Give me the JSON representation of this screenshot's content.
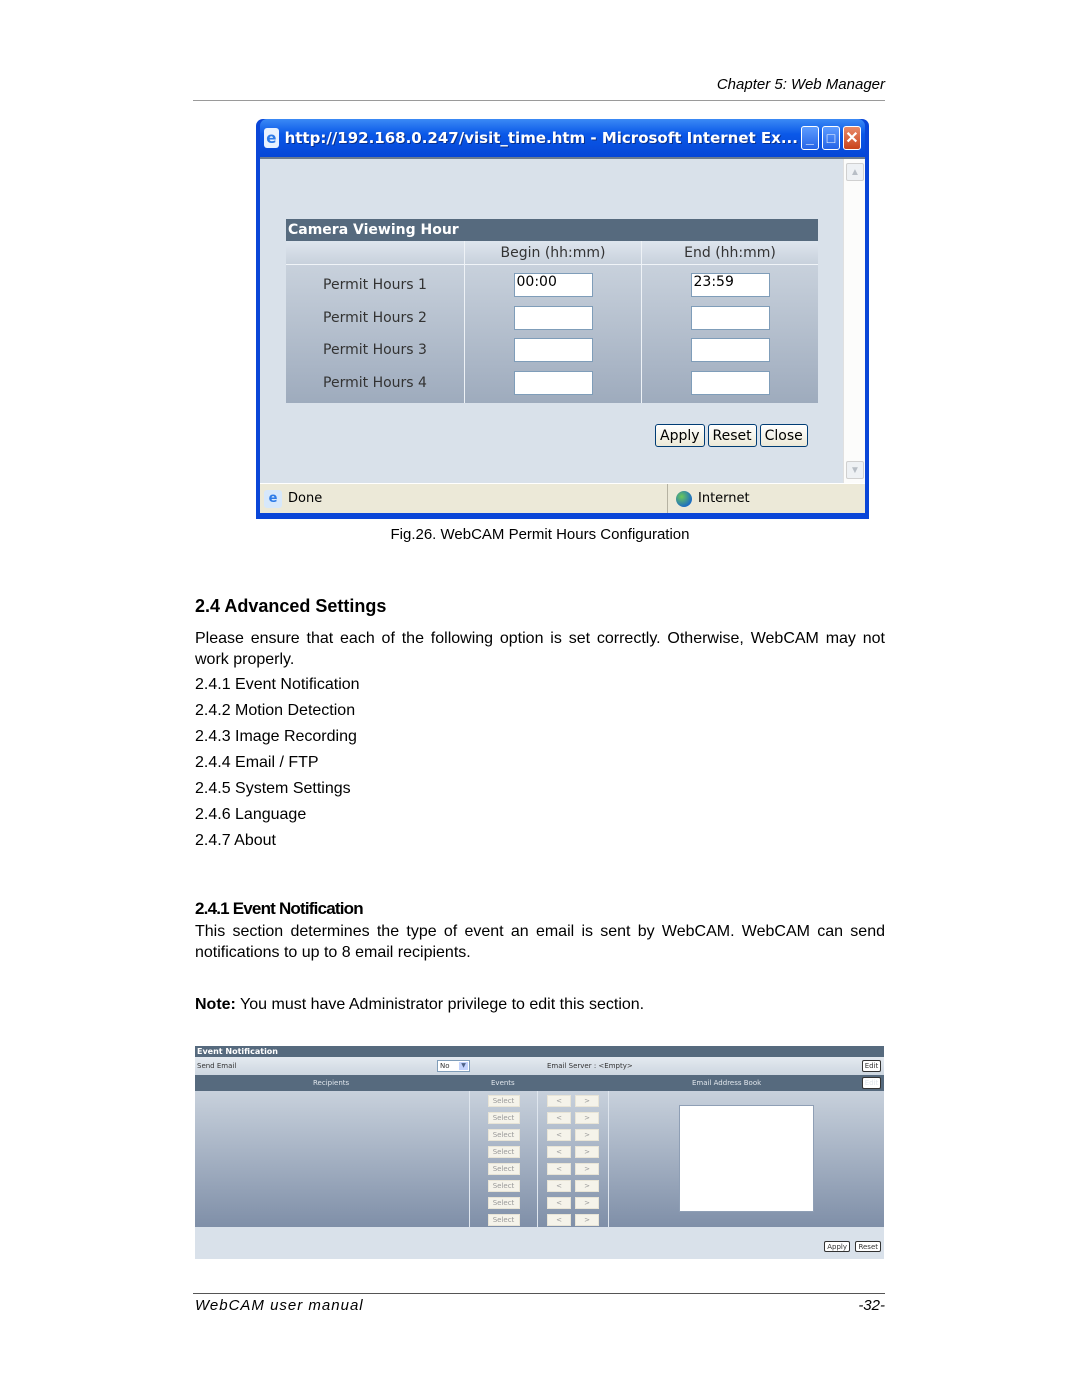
{
  "page_header": {
    "chapter": "Chapter 5: Web Manager"
  },
  "figure26": {
    "window": {
      "title": "http://192.168.0.247/visit_time.htm - Microsoft Internet Ex...",
      "minimize_glyph": "_",
      "maximize_glyph": "□",
      "close_glyph": "✕",
      "status_left": "Done",
      "status_zone": "Internet",
      "ie_glyph": "e"
    },
    "table": {
      "title": "Camera Viewing Hour",
      "col_begin": "Begin (hh:mm)",
      "col_end": "End (hh:mm)",
      "rows": [
        {
          "label": "Permit Hours 1",
          "begin": "00:00",
          "end": "23:59"
        },
        {
          "label": "Permit Hours 2",
          "begin": "",
          "end": ""
        },
        {
          "label": "Permit Hours 3",
          "begin": "",
          "end": ""
        },
        {
          "label": "Permit Hours 4",
          "begin": "",
          "end": ""
        }
      ]
    },
    "buttons": {
      "apply": "Apply",
      "reset": "Reset",
      "close": "Close"
    },
    "caption": "Fig.26.  WebCAM Permit Hours Configuration"
  },
  "section_24": {
    "heading": "2.4 Advanced Settings",
    "intro": "Please ensure that each of the following option is set correctly. Otherwise, WebCAM may not work properly.",
    "items": [
      "2.4.1 Event Notification",
      "2.4.2 Motion Detection",
      "2.4.3 Image Recording",
      "2.4.4 Email / FTP",
      "2.4.5 System Settings",
      "2.4.6 Language",
      "2.4.7 About"
    ]
  },
  "section_241": {
    "heading": "2.4.1 Event Notification",
    "body": "This section determines the type of event an email is sent by WebCAM.  WebCAM can send notifications to up to 8 email recipients.",
    "note_label": "Note:",
    "note_text": " You must have Administrator privilege to edit this section."
  },
  "event_panel": {
    "title": "Event Notification",
    "send_email_label": "Send Email",
    "send_email_value": "No",
    "email_server": "Email Server : <Empty>",
    "edit_label": "Edit",
    "col_recipients": "Recipients",
    "col_events": "Events",
    "col_address_book": "Email Address Book",
    "select_label": "Select",
    "left_arrow": "<",
    "right_arrow": ">",
    "apply": "Apply",
    "reset": "Reset",
    "rows": 8
  },
  "page_footer": {
    "left": "WebCAM user manual",
    "right": "-32-"
  }
}
